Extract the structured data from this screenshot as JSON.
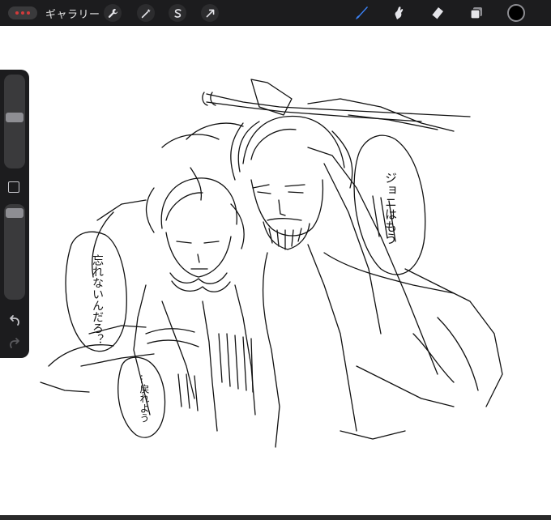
{
  "topbar": {
    "gallery_label": "ギャラリー",
    "left_tools": [
      "wrench-icon",
      "magic-wand-icon",
      "selection-icon",
      "transform-arrow-icon"
    ],
    "right_tools": [
      "brush-icon",
      "smudge-icon",
      "eraser-icon",
      "layers-icon"
    ],
    "accent": "#3b82f6",
    "current_color": "#000000"
  },
  "sidebar": {
    "size_slider_level": 0.55,
    "opacity_slider_level": 0.95
  },
  "canvas": {
    "speech_bubble_right": "ジョニはもう",
    "speech_bubble_left": "忘れないんだろ？",
    "speech_bubble_bottom": "…戻れよう"
  }
}
